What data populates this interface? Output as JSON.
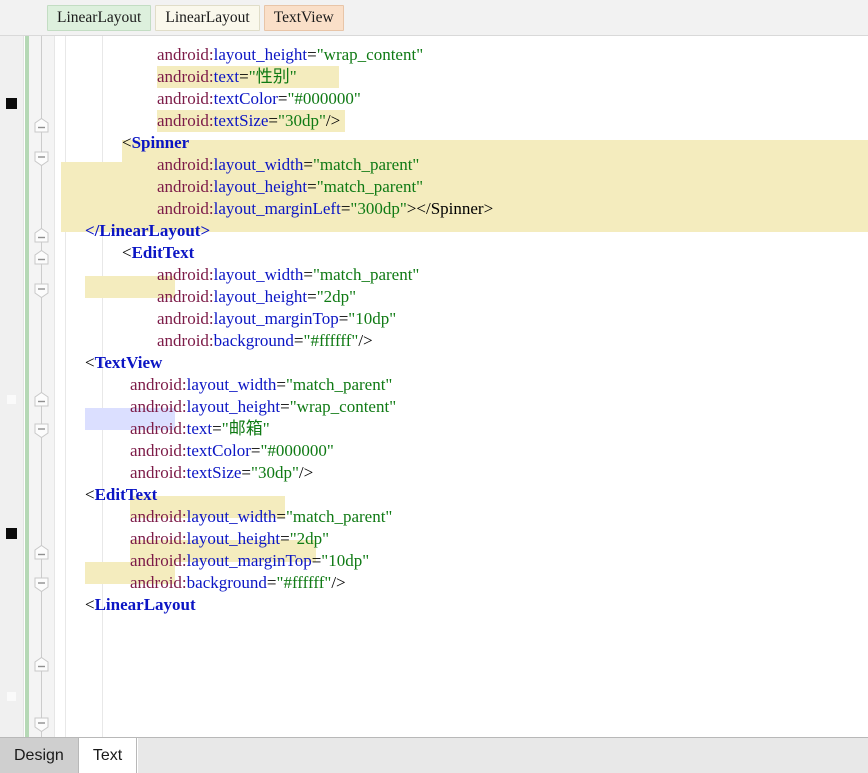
{
  "breadcrumb": {
    "name": "component-breadcrumb",
    "crumbs": [
      {
        "label": "LinearLayout",
        "color": "#ddf0dd"
      },
      {
        "label": "LinearLayout",
        "color": "#faf8ec"
      },
      {
        "label": "TextView",
        "color": "#fadfc8"
      }
    ]
  },
  "editor": {
    "file_type": "android-layout-xml",
    "colors": {
      "highlight_yellow": "#f4ecbe",
      "selection_blue": "#dbdfff",
      "namespace": "#7c1a47",
      "attribute": "#0b15c4",
      "value": "#0f7a14",
      "tag": "#0b15c4",
      "vcs_change_stripe": "#b5d8b5"
    },
    "lines": [
      {
        "indent": 101,
        "ns": "android:",
        "attr": "layout_height",
        "eq": "=",
        "val": "\"wrap_content\"",
        "tail": ""
      },
      {
        "indent": 101,
        "ns": "android:",
        "attr": "text",
        "eq": "=",
        "val": "\"性别\"",
        "tail": ""
      },
      {
        "indent": 101,
        "ns": "android:",
        "attr": "textColor",
        "eq": "=",
        "val": "\"#000000\"",
        "tail": ""
      },
      {
        "indent": 101,
        "ns": "android:",
        "attr": "textSize",
        "eq": "=",
        "val": "\"30dp\"",
        "tail": "/>"
      },
      {
        "indent": 66,
        "tag_open": "<",
        "tag": "Spinner"
      },
      {
        "indent": 101,
        "ns": "android:",
        "attr": "layout_width",
        "eq": "=",
        "val": "\"match_parent\"",
        "tail": ""
      },
      {
        "indent": 101,
        "ns": "android:",
        "attr": "layout_height",
        "eq": "=",
        "val": "\"match_parent\"",
        "tail": ""
      },
      {
        "indent": 101,
        "ns": "android:",
        "attr": "layout_marginLeft",
        "eq": "=",
        "val": "\"300dp\"",
        "tail": "></Spinner>"
      },
      {
        "indent": 29,
        "close_tag": "</LinearLayout>"
      },
      {
        "indent": 66,
        "tag_open": "<",
        "tag": "EditText"
      },
      {
        "indent": 101,
        "ns": "android:",
        "attr": "layout_width",
        "eq": "=",
        "val": "\"match_parent\"",
        "tail": ""
      },
      {
        "indent": 101,
        "ns": "android:",
        "attr": "layout_height",
        "eq": "=",
        "val": "\"2dp\"",
        "tail": ""
      },
      {
        "indent": 101,
        "ns": "android:",
        "attr": "layout_marginTop",
        "eq": "=",
        "val": "\"10dp\"",
        "tail": ""
      },
      {
        "indent": 101,
        "ns": "android:",
        "attr": "background",
        "eq": "=",
        "val": "\"#ffffff\"",
        "tail": "/>"
      },
      {
        "indent": 29,
        "tag_open": "<",
        "tag": "TextView"
      },
      {
        "indent": 74,
        "ns": "android:",
        "attr": "layout_width",
        "eq": "=",
        "val": "\"match_parent\"",
        "tail": ""
      },
      {
        "indent": 74,
        "ns": "android:",
        "attr": "layout_height",
        "eq": "=",
        "val": "\"wrap_content\"",
        "tail": ""
      },
      {
        "indent": 74,
        "ns": "android:",
        "attr": "text",
        "eq": "=",
        "val": "\"邮箱\"",
        "tail": ""
      },
      {
        "indent": 74,
        "ns": "android:",
        "attr": "textColor",
        "eq": "=",
        "val": "\"#000000\"",
        "tail": ""
      },
      {
        "indent": 74,
        "ns": "android:",
        "attr": "textSize",
        "eq": "=",
        "val": "\"30dp\"",
        "tail": "/>"
      },
      {
        "indent": 29,
        "tag_open": "<",
        "tag": "EditText"
      },
      {
        "indent": 74,
        "ns": "android:",
        "attr": "layout_width",
        "eq": "=",
        "val": "\"match_parent\"",
        "tail": ""
      },
      {
        "indent": 74,
        "ns": "android:",
        "attr": "layout_height",
        "eq": "=",
        "val": "\"2dp\"",
        "tail": ""
      },
      {
        "indent": 74,
        "ns": "android:",
        "attr": "layout_marginTop",
        "eq": "=",
        "val": "\"10dp\"",
        "tail": ""
      },
      {
        "indent": 74,
        "ns": "android:",
        "attr": "background",
        "eq": "=",
        "val": "\"#ffffff\"",
        "tail": "/>"
      },
      {
        "indent": 29,
        "tag_open": "<",
        "tag": "LinearLayout"
      }
    ]
  },
  "tabs": {
    "name": "editor-mode-tabs",
    "items": [
      {
        "label": "Design",
        "active": false
      },
      {
        "label": "Text",
        "active": true
      }
    ]
  }
}
